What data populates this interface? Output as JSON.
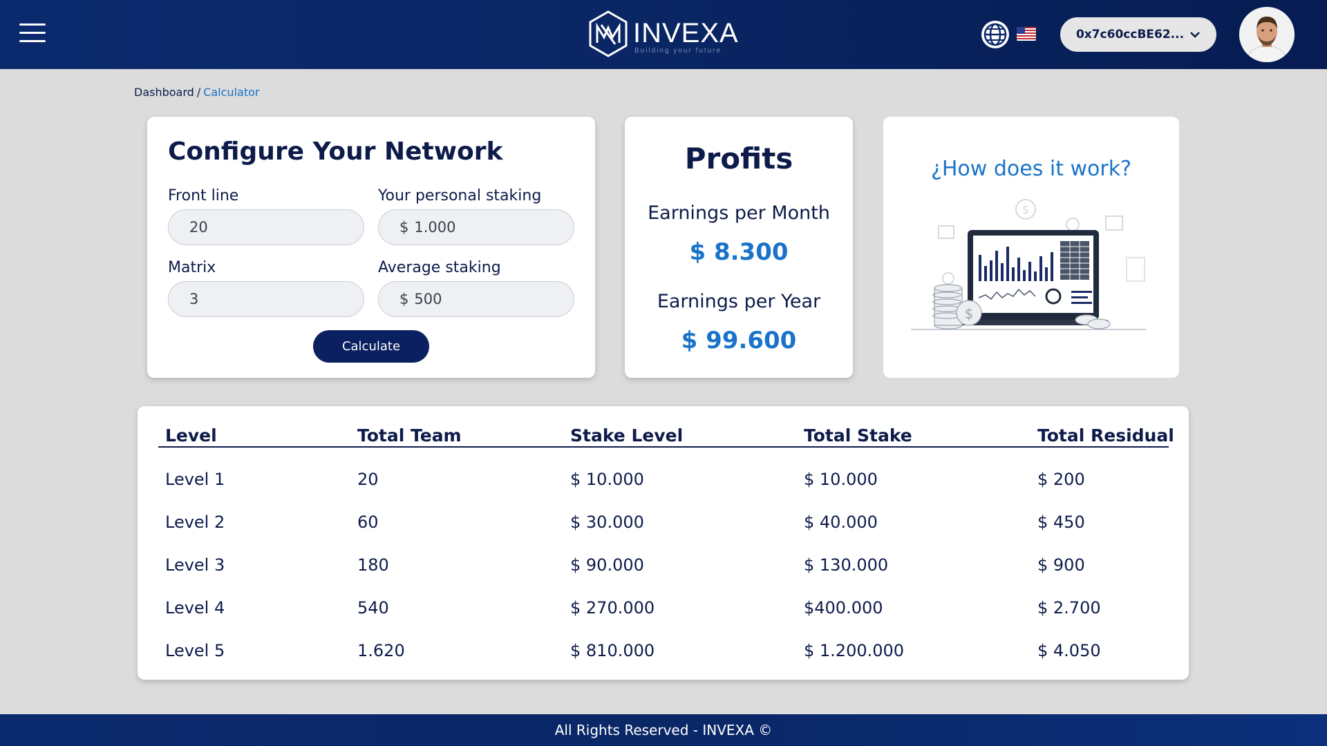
{
  "header": {
    "brand": "INVEXA",
    "tagline": "Building your future",
    "wallet_address": "0x7c60ccBE62...",
    "icons": {
      "menu": "hamburger-icon",
      "language": "globe-icon",
      "flag": "us-flag-icon",
      "wallet_dropdown": "chevron-down-icon"
    }
  },
  "breadcrumb": {
    "root": "Dashboard",
    "separator": "/",
    "current": "Calculator"
  },
  "config": {
    "title": "Configure Your Network",
    "front_line_label": "Front line",
    "front_line_value": "20",
    "personal_staking_label": "Your personal staking",
    "personal_staking_prefix": "$",
    "personal_staking_value": "1.000",
    "matrix_label": "Matrix",
    "matrix_value": "3",
    "average_staking_label": "Average staking",
    "average_staking_prefix": "$",
    "average_staking_value": "500",
    "calculate_label": "Calculate"
  },
  "profits": {
    "title": "Profits",
    "month_label": "Earnings per Month",
    "month_value": "$ 8.300",
    "year_label": "Earnings per Year",
    "year_value": "$ 99.600"
  },
  "how": {
    "title": "¿How does it work?"
  },
  "table": {
    "headers": [
      "Level",
      "Total Team",
      "Stake Level",
      "Total Stake",
      "Total Residual"
    ],
    "rows": [
      [
        "Level 1",
        "20",
        "$ 10.000",
        "$ 10.000",
        "$ 200"
      ],
      [
        "Level 2",
        "60",
        "$ 30.000",
        "$ 40.000",
        "$ 450"
      ],
      [
        "Level 3",
        "180",
        "$ 90.000",
        "$ 130.000",
        "$ 900"
      ],
      [
        "Level 4",
        "540",
        "$ 270.000",
        "$400.000",
        "$ 2.700"
      ],
      [
        "Level 5",
        "1.620",
        "$ 810.000",
        "$ 1.200.000",
        "$ 4.050"
      ]
    ]
  },
  "footer": {
    "text": "All Rights Reserved - INVEXA ©"
  },
  "colors": {
    "header_bg": "#0b2a6e",
    "accent_blue": "#1a73c9",
    "button_bg": "#0b2060",
    "text_dark": "#0d1b4a",
    "page_bg": "#dcdcdc"
  }
}
